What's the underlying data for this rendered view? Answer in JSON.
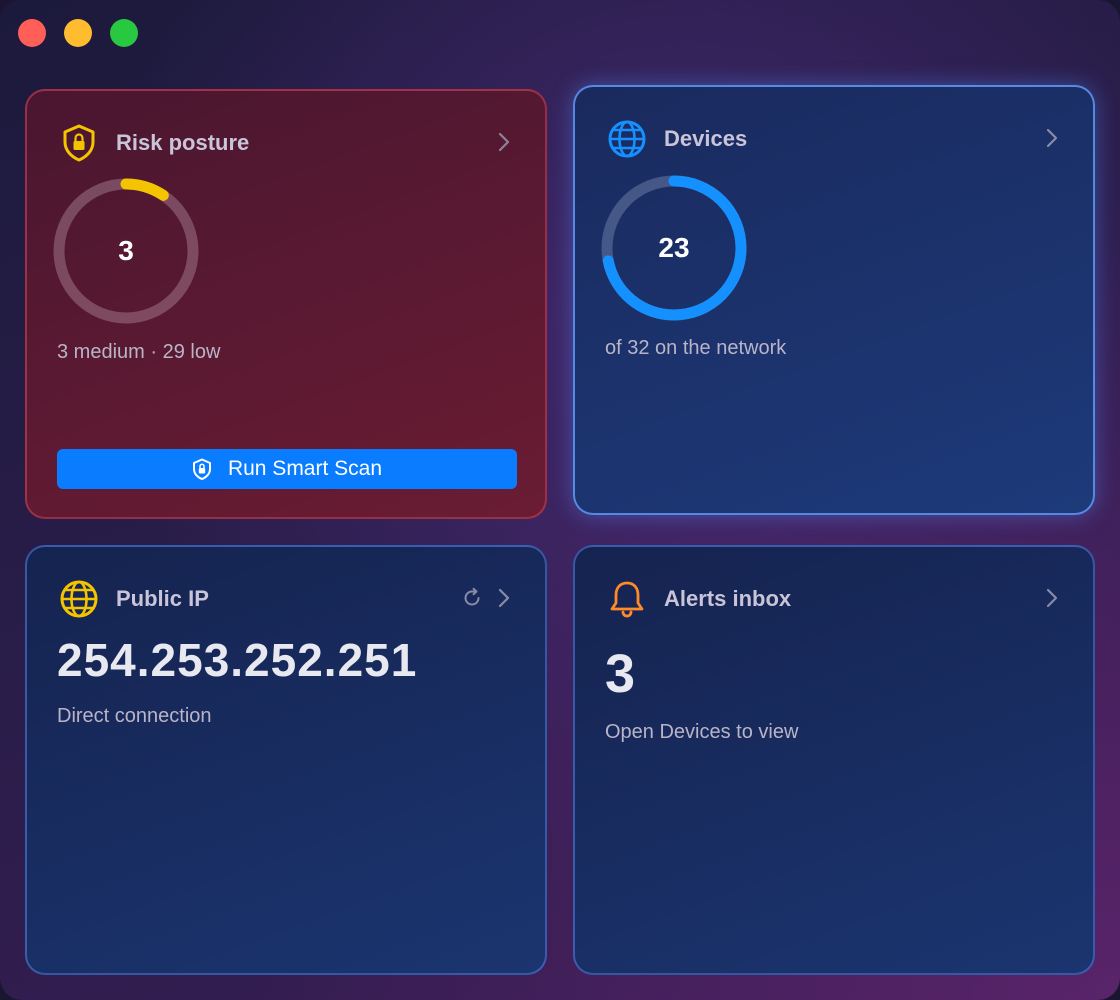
{
  "window": {
    "controls": [
      "close",
      "minimize",
      "zoom"
    ]
  },
  "risk": {
    "title": "Risk posture",
    "icon": "shield-lock-icon",
    "ring_value": "3",
    "ring_fraction": 0.094,
    "ring_color": "#f5c400",
    "summary": "3 medium · 29 low",
    "scan_button": "Run Smart Scan"
  },
  "devices": {
    "title": "Devices",
    "icon": "globe-icon",
    "ring_value": "23",
    "ring_fraction": 0.719,
    "ring_color": "#1591ff",
    "summary": "of 32 on the network"
  },
  "public_ip": {
    "title": "Public IP",
    "icon": "globe-icon",
    "address": "254.253.252.251",
    "connection": "Direct connection"
  },
  "alerts": {
    "title": "Alerts inbox",
    "icon": "bell-icon",
    "count": "3",
    "hint": "Open Devices to view"
  },
  "colors": {
    "accent_blue": "#0a7cff",
    "warning_yellow": "#f5c400",
    "alert_orange": "#ff8a2a"
  }
}
